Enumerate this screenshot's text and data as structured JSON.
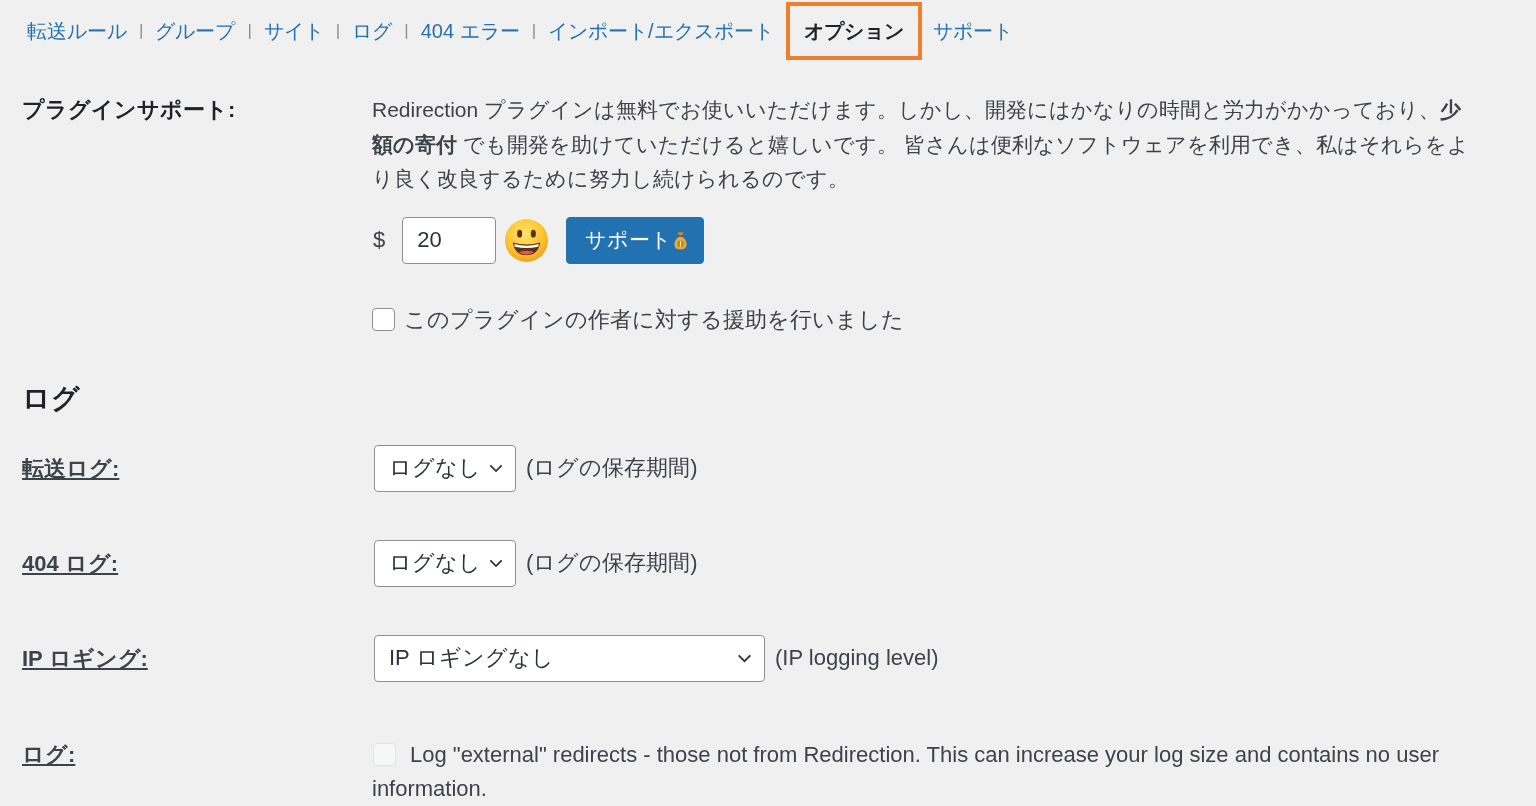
{
  "nav": {
    "items": [
      {
        "label": "転送ルール",
        "selected": false,
        "separator": "|"
      },
      {
        "label": "グループ",
        "selected": false,
        "separator": "|"
      },
      {
        "label": "サイト",
        "selected": false,
        "separator": "|"
      },
      {
        "label": "ログ",
        "selected": false,
        "separator": "|"
      },
      {
        "label": "404 エラー",
        "selected": false,
        "separator": "|"
      },
      {
        "label": "インポート/エクスポート",
        "selected": false
      },
      {
        "label": "オプション",
        "selected": true
      },
      {
        "label": "サポート",
        "selected": false
      }
    ]
  },
  "plugin_support": {
    "label": "プラグインサポート:",
    "text": "Redirection プラグインは無料でお使いいただけます。しかし、開発にはかなりの時間と労力がかかっており、**少額の寄付** でも開発を助けていただけると嬉しいです。 皆さんは便利なソフトウェアを利用でき、私はそれらをより良く改良するために努力し続けられるのです。",
    "currency": "$",
    "amount": "20",
    "button": "サポート",
    "checkbox": {
      "label": "このプラグインの作者に対する援助を行いました",
      "checked": false
    }
  },
  "log_section": {
    "heading": "ログ",
    "rows": [
      {
        "kind": "select",
        "label": "転送ログ:",
        "value": "ログなし",
        "hint": "(ログの保存期間)"
      },
      {
        "kind": "select",
        "label": "404 ログ:",
        "value": "ログなし",
        "hint": "(ログの保存期間)"
      },
      {
        "kind": "select",
        "label": "IP ロギング:",
        "value": "IP ロギングなし",
        "hint": "(IP logging level)"
      },
      {
        "kind": "checkbox",
        "label": "ログ:",
        "text": "Log \"external\" redirects - those not from Redirection. This can increase your log size and contains no user information.",
        "checked": false,
        "disabled": true
      }
    ]
  }
}
